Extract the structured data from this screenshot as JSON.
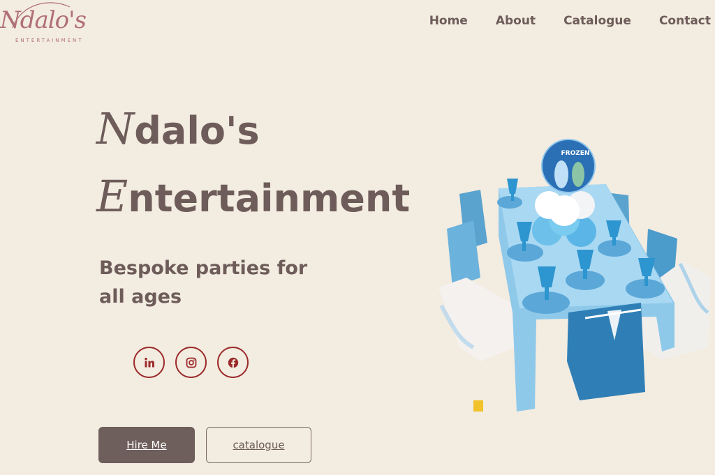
{
  "logo": {
    "script_text": "Ndalo's",
    "sub_text": "ENTERTAINMENT",
    "color": "#b06f78"
  },
  "nav": {
    "items": [
      {
        "label": "Home"
      },
      {
        "label": "About"
      },
      {
        "label": "Catalogue"
      },
      {
        "label": "Contact"
      }
    ]
  },
  "hero": {
    "title_line1_cap": "N",
    "title_line1_rest": "dalo's",
    "title_line2_cap": "E",
    "title_line2_rest": "ntertainment",
    "tagline": "Bespoke parties for all ages",
    "balloon_label": "FROZEN",
    "image_icon": "party-table-icon"
  },
  "social": {
    "items": [
      {
        "name": "linkedin",
        "icon": "linkedin-icon"
      },
      {
        "name": "instagram",
        "icon": "instagram-icon"
      },
      {
        "name": "facebook",
        "icon": "facebook-icon"
      }
    ],
    "accent_color": "#9b2b2b"
  },
  "buttons": {
    "hire_label": "Hire Me",
    "catalogue_label": "catalogue"
  },
  "colors": {
    "background": "#f3ece0",
    "text": "#6d5c5a",
    "primary_button": "#6e5e5c",
    "accent": "#9b2b2b"
  }
}
